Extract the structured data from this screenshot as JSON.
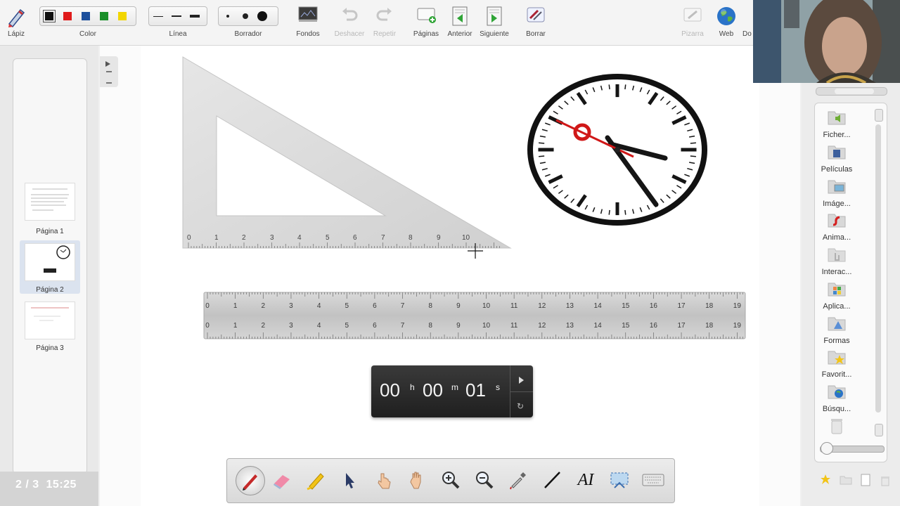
{
  "toolbar": {
    "pencil_label": "Lápiz",
    "color_label": "Color",
    "line_label": "Línea",
    "eraser_label": "Borrador",
    "backgrounds_label": "Fondos",
    "undo_label": "Deshacer",
    "redo_label": "Repetir",
    "pages_label": "Páginas",
    "previous_label": "Anterior",
    "next_label": "Siguiente",
    "clear_label": "Borrar",
    "whiteboard_label": "Pizarra",
    "web_label": "Web",
    "more_label": "Do",
    "colors": [
      "#111111",
      "#e01b1b",
      "#1d4f9c",
      "#1a8f2a",
      "#f2d600"
    ]
  },
  "pages": {
    "items": [
      {
        "label": "Página 1"
      },
      {
        "label": "Página 2"
      },
      {
        "label": "Página 3"
      }
    ],
    "counter": "2 / 3",
    "time": "15:25",
    "selected_index": 1
  },
  "gallery": {
    "items": [
      {
        "label": "Ficher...",
        "icon": "speaker-folder-icon"
      },
      {
        "label": "Películas",
        "icon": "film-folder-icon"
      },
      {
        "label": "Imáge...",
        "icon": "image-folder-icon"
      },
      {
        "label": "Anima...",
        "icon": "flash-folder-icon"
      },
      {
        "label": "Interac...",
        "icon": "hand-folder-icon"
      },
      {
        "label": "Aplica...",
        "icon": "apps-folder-icon"
      },
      {
        "label": "Formas",
        "icon": "shapes-folder-icon"
      },
      {
        "label": "Favorit...",
        "icon": "star-folder-icon"
      },
      {
        "label": "Búsqu...",
        "icon": "globe-folder-icon"
      }
    ]
  },
  "triangle_ruler": {
    "ticks": [
      "0",
      "1",
      "2",
      "3",
      "4",
      "5",
      "6",
      "7",
      "8",
      "9",
      "10"
    ]
  },
  "ruler": {
    "ticks": [
      "0",
      "1",
      "2",
      "3",
      "4",
      "5",
      "6",
      "7",
      "8",
      "9",
      "10",
      "11",
      "12",
      "13",
      "14",
      "15",
      "16",
      "17",
      "18",
      "19"
    ]
  },
  "timer": {
    "hours": "00",
    "hours_unit": "h",
    "minutes": "00",
    "minutes_unit": "m",
    "seconds": "01",
    "seconds_unit": "s"
  },
  "bottom_tools": {
    "text_tool_label": "AI"
  }
}
